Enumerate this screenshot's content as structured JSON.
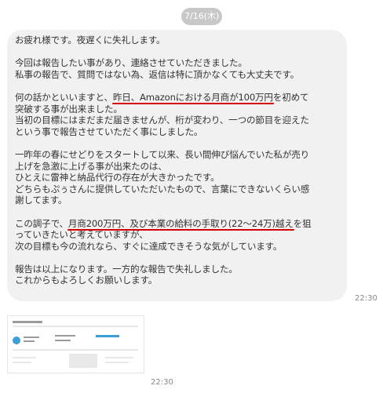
{
  "date_label": "7/16(木)",
  "message": {
    "lines": [
      {
        "segments": [
          {
            "text": "お疲れ様です。夜遅くに失礼します。"
          }
        ]
      },
      {
        "blank": true
      },
      {
        "segments": [
          {
            "text": "今回は報告したい事があり、連絡させていただきました。"
          }
        ]
      },
      {
        "segments": [
          {
            "text": "私事の報告で、質問ではない為、返信は特に頂かなくても大丈夫です。"
          }
        ]
      },
      {
        "blank": true
      },
      {
        "segments": [
          {
            "text": "何の話かといいますと、"
          },
          {
            "text": "昨日、Amazonにおける月商が100万円",
            "highlight": true
          },
          {
            "text": "を初めて"
          }
        ]
      },
      {
        "segments": [
          {
            "text": "突破する事が出来ました。"
          }
        ]
      },
      {
        "segments": [
          {
            "text": "当初の目標にはまだまだ届きませんが、桁が変わり、一つの節目を迎えた"
          }
        ]
      },
      {
        "segments": [
          {
            "text": "という事で報告させていただく事にしました。"
          }
        ]
      },
      {
        "blank": true
      },
      {
        "segments": [
          {
            "text": "一昨年の春にせどりをスタートして以来、長い間伸び悩んでいた私が売り"
          }
        ]
      },
      {
        "segments": [
          {
            "text": "上げを急激に上げる事が出来たのは、"
          }
        ]
      },
      {
        "segments": [
          {
            "text": "ひとえに雷神と納品代行の存在が大きかったです。"
          }
        ]
      },
      {
        "segments": [
          {
            "text": "どちらもぷぅさんに提供していただいたもので、言葉にできないくらい感"
          }
        ]
      },
      {
        "segments": [
          {
            "text": "謝してます。"
          }
        ]
      },
      {
        "blank": true
      },
      {
        "segments": [
          {
            "text": "この調子で、"
          },
          {
            "text": "月商200万円、及び本業の給料の手取り(22〜24万)越え",
            "highlight": true
          },
          {
            "text": "を狙"
          }
        ]
      },
      {
        "segments": [
          {
            "text": "っていきたいと考えていますが、"
          }
        ]
      },
      {
        "segments": [
          {
            "text": "次の目標も今の流れなら、すぐに達成できそうな気がしています。"
          }
        ]
      },
      {
        "blank": true
      },
      {
        "segments": [
          {
            "text": "報告は以上になります。一方的な報告で失礼しました。"
          }
        ]
      },
      {
        "segments": [
          {
            "text": "これからもよろしくお願いします。"
          }
        ]
      }
    ],
    "time": "22:30"
  },
  "attachment": {
    "time": "22:30"
  },
  "colors": {
    "bubble_bg": "#f1f1f1",
    "highlight_underline": "#d70000",
    "date_badge_bg": "#c8c8c8"
  }
}
